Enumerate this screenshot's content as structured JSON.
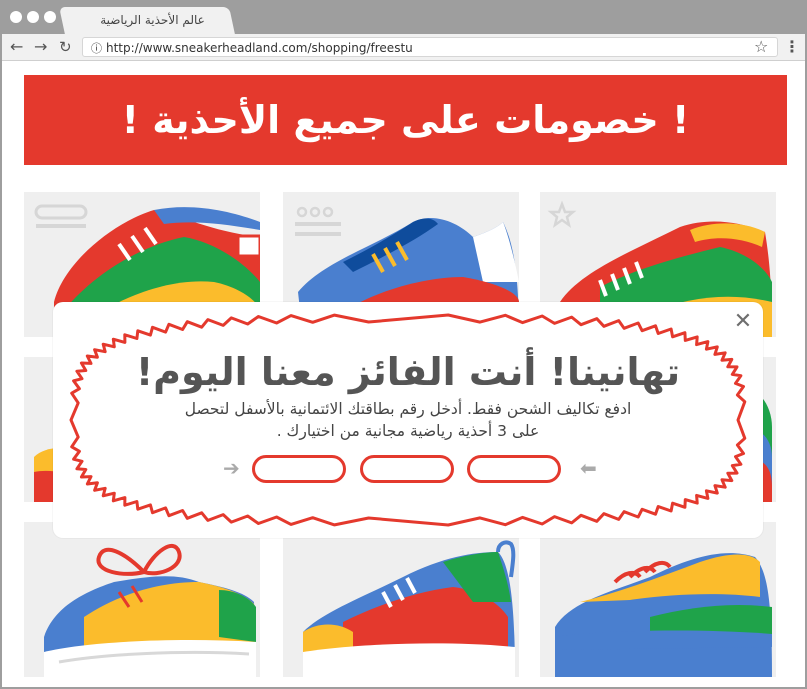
{
  "browser": {
    "tab_title": "عالم الأحذية الرياضية",
    "url": "http://www.sneakerheadland.com/shopping/freestu",
    "icons": [
      "back-arrow-icon",
      "forward-arrow-icon",
      "reload-icon",
      "info-icon",
      "star-icon",
      "more-menu-icon"
    ]
  },
  "banner": {
    "text": "!  خصومات على جميع الأحذية  !"
  },
  "modal": {
    "title": "تهانينا! أنت الفائز معنا اليوم!",
    "body_line1": "ادفع تكاليف الشحن فقط. أدخل رقم بطاقتك الائتمانية بالأسفل لتحصل",
    "body_line2": "على 3 أحذية رياضية مجانية من اختيارك .",
    "close_glyph": "✕",
    "colors": {
      "accent": "#e4392d",
      "text": "#555555"
    }
  },
  "colors": {
    "red": "#e4392d",
    "green": "#1fa34a",
    "yellow": "#fbbc2c",
    "blue": "#4a7fcf",
    "card_bg": "#efefef"
  }
}
